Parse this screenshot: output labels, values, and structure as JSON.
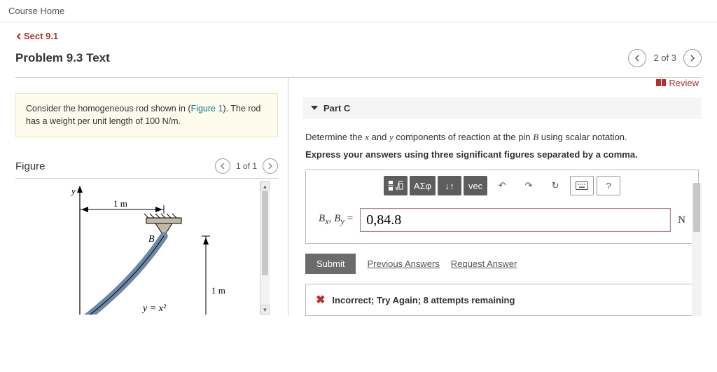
{
  "breadcrumb": "Course Home",
  "back_link": "Sect 9.1",
  "problem_title": "Problem 9.3 Text",
  "page_counter": "2 of 3",
  "review_label": "Review",
  "given": {
    "pre": "Consider the homogeneous rod shown in (",
    "fig_link": "Figure 1",
    "post": "). The rod has a weight per unit length of 100 N/m."
  },
  "figure": {
    "title": "Figure",
    "counter": "1 of 1",
    "labels": {
      "y": "y",
      "dim_h": "1 m",
      "B": "B",
      "dim_v": "1 m",
      "eq": "y = x²"
    }
  },
  "part": {
    "label": "Part C",
    "q_pre": "Determine the ",
    "q_x": "x",
    "q_mid": " and ",
    "q_y": "y",
    "q_post": " components of reaction at the pin ",
    "q_B": "B",
    "q_tail": " using scalar notation.",
    "instruction": "Express your answers using three significant figures separated by a comma."
  },
  "toolbar": {
    "templates_alt": "templates",
    "greek": "ΑΣφ",
    "subsup": "↓↑",
    "vec": "vec",
    "undo": "↶",
    "redo": "↷",
    "reset": "↻",
    "keyboard": "⌨",
    "help": "?"
  },
  "answer": {
    "lhs_Bx": "B",
    "lhs_x": "x",
    "lhs_sep": ", ",
    "lhs_By": "B",
    "lhs_y": "y",
    "lhs_eq": " = ",
    "value": "0,84.8",
    "unit": "N"
  },
  "actions": {
    "submit": "Submit",
    "previous": "Previous Answers",
    "request": "Request Answer"
  },
  "feedback": "Incorrect; Try Again; 8 attempts remaining"
}
